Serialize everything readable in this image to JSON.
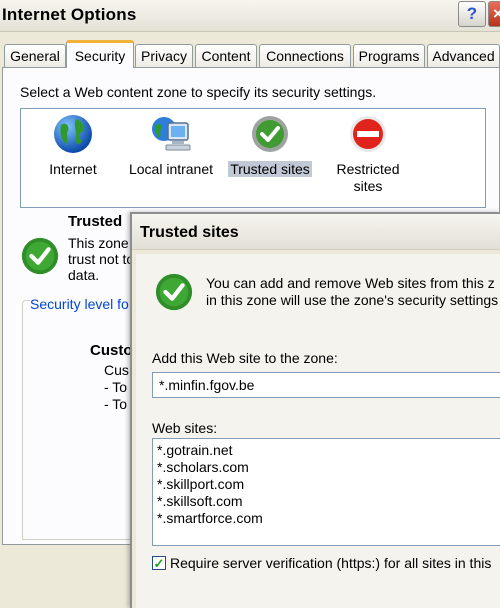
{
  "main_window": {
    "title": "Internet Options",
    "help_label": "?",
    "close_label": "×"
  },
  "tabs": [
    {
      "label": "General",
      "active": false
    },
    {
      "label": "Security",
      "active": true
    },
    {
      "label": "Privacy",
      "active": false
    },
    {
      "label": "Content",
      "active": false
    },
    {
      "label": "Connections",
      "active": false
    },
    {
      "label": "Programs",
      "active": false
    },
    {
      "label": "Advanced",
      "active": false
    }
  ],
  "security": {
    "instruction": "Select a Web content zone to specify its security settings.",
    "zones": [
      {
        "label": "Internet",
        "icon": "globe-icon"
      },
      {
        "label": "Local intranet",
        "icon": "computer-globe-icon"
      },
      {
        "label": "Trusted sites",
        "icon": "green-check-icon",
        "selected": true
      },
      {
        "label_line1": "Restricted",
        "label_line2": "sites",
        "icon": "restricted-icon"
      }
    ],
    "selected_zone_heading": "Trusted",
    "selected_zone_desc": [
      "This zone",
      "trust not to",
      "data."
    ],
    "level_group_label": "Security level fo",
    "custom_title": "Custo",
    "custom_lines": [
      "Cus",
      "- To",
      "- To"
    ]
  },
  "trusted_dialog": {
    "title": "Trusted sites",
    "info_line1": "You can add and remove Web sites from this z",
    "info_line2": "in this zone will use the zone's security settings",
    "add_label": "Add this Web site to the zone:",
    "add_value": "*.minfin.fgov.be",
    "websites_label": "Web sites:",
    "websites": [
      "*.gotrain.net",
      "*.scholars.com",
      "*.skillport.com",
      "*.skillsoft.com",
      "*.smartforce.com"
    ],
    "require_label": "Require server verification (https:) for all sites in this",
    "require_checked": true
  },
  "colors": {
    "dialog_bg": "#ece9d8",
    "tab_active_accent": "#f2b23a",
    "link_blue": "#0046d5",
    "check_green": "#3a9a2e"
  }
}
